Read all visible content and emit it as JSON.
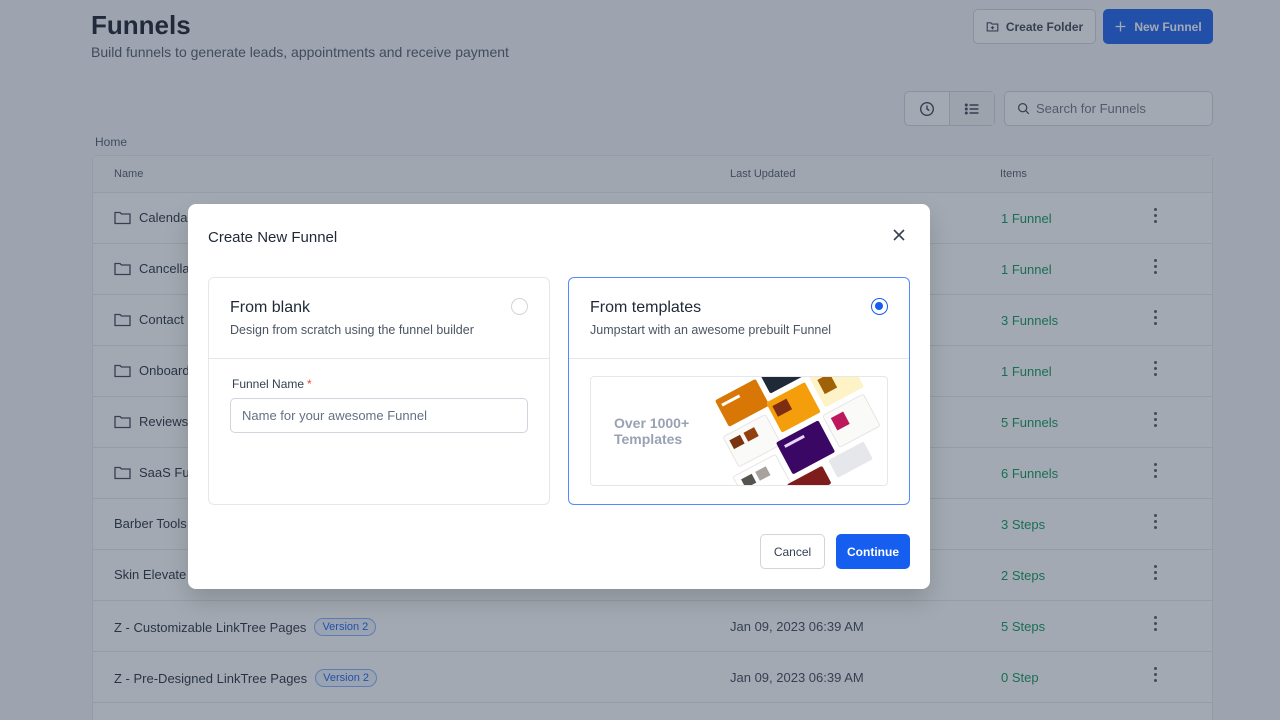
{
  "header": {
    "title": "Funnels",
    "subtitle": "Build funnels to generate leads, appointments and receive payment",
    "create_folder_label": "Create Folder",
    "new_funnel_label": "New Funnel"
  },
  "toolbar": {
    "search_placeholder": "Search for Funnels",
    "recent_icon": "clock-icon",
    "list_icon": "list-view-icon"
  },
  "breadcrumb": "Home",
  "table": {
    "columns": [
      "Name",
      "Last Updated",
      "Items"
    ],
    "rows": [
      {
        "name": "Calenda",
        "is_folder": true,
        "last_updated": "",
        "items": "1 Funnel"
      },
      {
        "name": "Cancella",
        "is_folder": true,
        "last_updated": "",
        "items": "1 Funnel"
      },
      {
        "name": "Contact",
        "is_folder": true,
        "last_updated": "",
        "items": "3 Funnels"
      },
      {
        "name": "Onboard",
        "is_folder": true,
        "last_updated": "",
        "items": "1 Funnel"
      },
      {
        "name": "Reviews",
        "is_folder": true,
        "last_updated": "",
        "items": "5 Funnels"
      },
      {
        "name": "SaaS Fu",
        "is_folder": true,
        "last_updated": "",
        "items": "6 Funnels"
      },
      {
        "name": "Barber Tools",
        "is_folder": false,
        "last_updated": "",
        "items": "3 Steps"
      },
      {
        "name": "Skin Elevate",
        "is_folder": false,
        "last_updated": "",
        "items": "2 Steps"
      },
      {
        "name": "Z - Customizable LinkTree Pages",
        "is_folder": false,
        "badge": "Version 2",
        "last_updated": "Jan 09, 2023 06:39 AM",
        "items": "5 Steps"
      },
      {
        "name": "Z - Pre-Designed LinkTree Pages",
        "is_folder": false,
        "badge": "Version 2",
        "last_updated": "Jan 09, 2023 06:39 AM",
        "items": "0 Step"
      }
    ]
  },
  "modal": {
    "title": "Create New Funnel",
    "blank": {
      "title": "From blank",
      "description": "Design from scratch using the funnel builder",
      "selected": false,
      "field_label": "Funnel Name",
      "required_mark": "*",
      "field_placeholder": "Name for your awesome Funnel"
    },
    "templates": {
      "title": "From templates",
      "description": "Jumpstart with an awesome prebuilt Funnel",
      "selected": true,
      "preview_line1": "Over 1000+",
      "preview_line2": "Templates"
    },
    "cancel_label": "Cancel",
    "continue_label": "Continue"
  },
  "colors": {
    "primary": "#155eef",
    "items_green": "#079455",
    "overlay": "rgba(52,64,84,0.45)"
  }
}
